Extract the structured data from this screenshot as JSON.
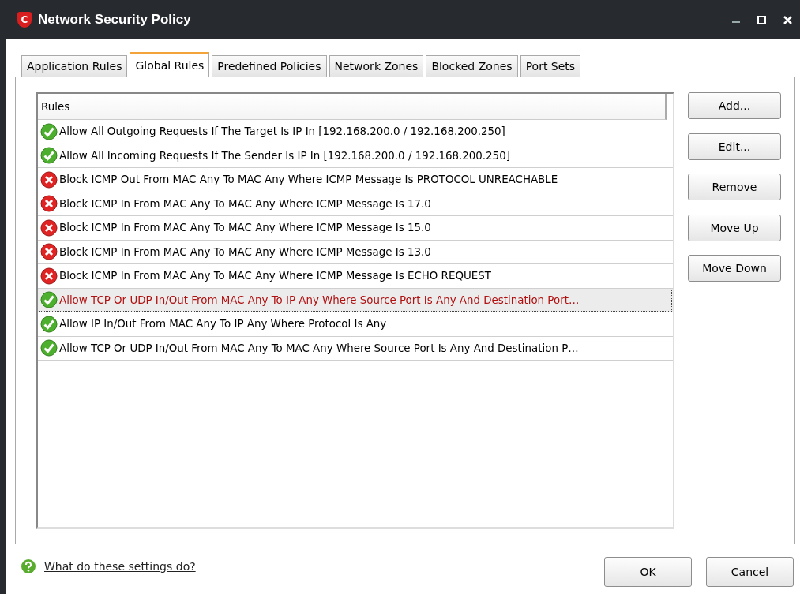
{
  "window": {
    "logo": "C",
    "title": "Network Security Policy"
  },
  "tabs": [
    {
      "label": "Application Rules",
      "selected": false
    },
    {
      "label": "Global Rules",
      "selected": true
    },
    {
      "label": "Predefined Policies",
      "selected": false
    },
    {
      "label": "Network Zones",
      "selected": false
    },
    {
      "label": "Blocked Zones",
      "selected": false
    },
    {
      "label": "Port Sets",
      "selected": false
    }
  ],
  "rules": {
    "column": "Rules",
    "rows": [
      {
        "kind": "allow",
        "text": "Allow All Outgoing Requests If The Target Is IP In [192.168.200.0 / 192.168.200.250]",
        "selected": false
      },
      {
        "kind": "allow",
        "text": "Allow All Incoming Requests If The Sender Is IP In [192.168.200.0 / 192.168.200.250]",
        "selected": false
      },
      {
        "kind": "block",
        "text": "Block ICMP Out From MAC Any To MAC Any Where ICMP Message Is PROTOCOL UNREACHABLE",
        "selected": false
      },
      {
        "kind": "block",
        "text": "Block ICMP In From MAC Any To MAC Any Where ICMP Message Is 17.0",
        "selected": false
      },
      {
        "kind": "block",
        "text": "Block ICMP In From MAC Any To MAC Any Where ICMP Message Is 15.0",
        "selected": false
      },
      {
        "kind": "block",
        "text": "Block ICMP In From MAC Any To MAC Any Where ICMP Message Is 13.0",
        "selected": false
      },
      {
        "kind": "block",
        "text": "Block ICMP In From MAC Any To MAC Any Where ICMP Message Is ECHO REQUEST",
        "selected": false
      },
      {
        "kind": "allow",
        "text": "Allow TCP Or UDP In/Out From MAC Any To IP Any Where Source Port Is Any And Destination Port…",
        "selected": true
      },
      {
        "kind": "allow",
        "text": "Allow IP In/Out From MAC Any To IP Any Where Protocol Is Any",
        "selected": false
      },
      {
        "kind": "allow",
        "text": "Allow TCP Or UDP In/Out From MAC Any To MAC Any Where Source Port Is Any And Destination P…",
        "selected": false
      }
    ]
  },
  "buttons": [
    "Add...",
    "Edit...",
    "Remove",
    "Move Up",
    "Move Down"
  ],
  "help_link": "What do these settings do?",
  "footer_buttons": [
    "OK",
    "Cancel"
  ]
}
